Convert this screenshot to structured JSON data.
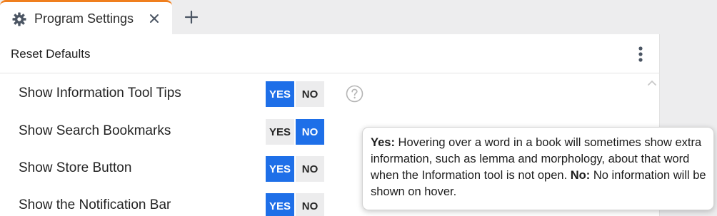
{
  "tab": {
    "title": "Program Settings",
    "icon": "gear-icon",
    "accent_color": "#f07f1e"
  },
  "header": {
    "reset_label": "Reset Defaults",
    "menu_icon": "kebab-menu-icon"
  },
  "toggle_colors": {
    "on": "#1e6fe8",
    "off": "#ececed"
  },
  "settings": [
    {
      "label": "Show Information Tool Tips",
      "yes": "YES",
      "no": "NO",
      "value": "YES"
    },
    {
      "label": "Show Search Bookmarks",
      "yes": "YES",
      "no": "NO",
      "value": "NO"
    },
    {
      "label": "Show Store Button",
      "yes": "YES",
      "no": "NO",
      "value": "YES"
    },
    {
      "label": "Show the Notification Bar",
      "yes": "YES",
      "no": "NO",
      "value": "YES"
    }
  ],
  "tooltip": {
    "yes_term": "Yes:",
    "yes_text": " Hovering over a word in a book will sometimes show extra information, such as lemma and morphology, about that word when the Information tool is not open. ",
    "no_term": "No:",
    "no_text": " No information will be shown on hover."
  }
}
